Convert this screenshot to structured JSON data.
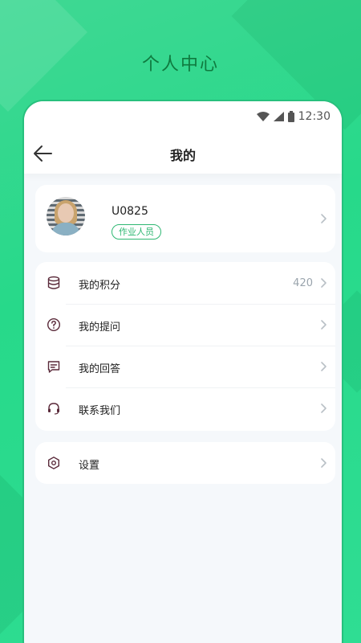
{
  "promo_title": "个人中心",
  "status_bar": {
    "time": "12:30"
  },
  "nav": {
    "title": "我的"
  },
  "profile": {
    "username": "U0825",
    "role_badge": "作业人员"
  },
  "menu": [
    {
      "id": "points",
      "label": "我的积分",
      "value": "420",
      "icon": "database-icon"
    },
    {
      "id": "questions",
      "label": "我的提问",
      "value": "",
      "icon": "question-circle-icon"
    },
    {
      "id": "answers",
      "label": "我的回答",
      "value": "",
      "icon": "message-square-icon"
    },
    {
      "id": "contact",
      "label": "联系我们",
      "value": "",
      "icon": "headset-icon"
    }
  ],
  "settings": {
    "label": "设置",
    "icon": "settings-hexagon-icon"
  },
  "colors": {
    "brand_green": "#27d98a",
    "badge_green": "#2fb873",
    "icon_dark": "#5a2a3a"
  }
}
